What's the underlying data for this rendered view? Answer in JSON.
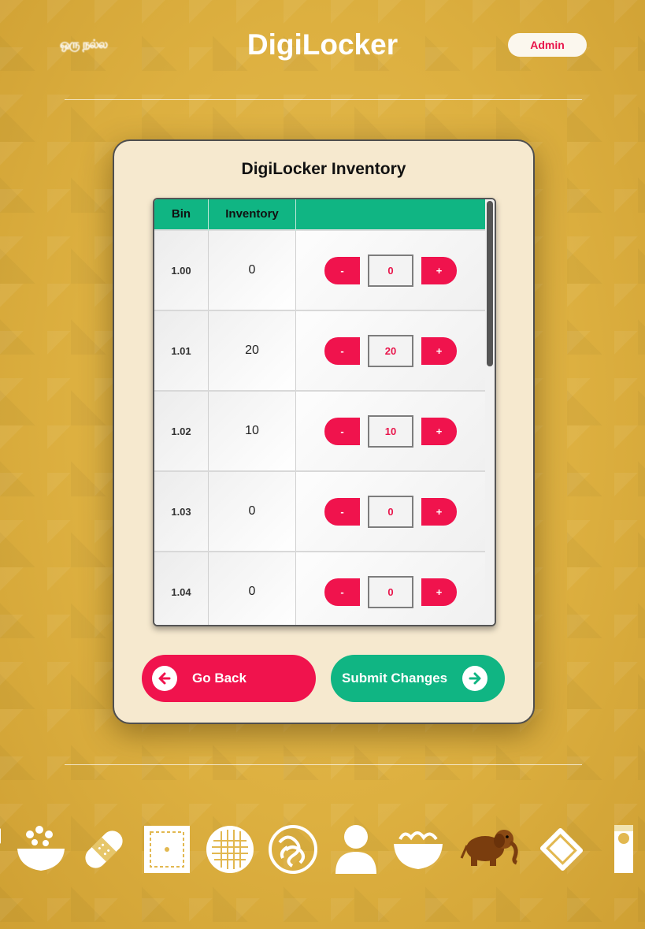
{
  "header": {
    "brand_logo_text": "ஒரு நல்ல",
    "app_title": "DigiLocker",
    "admin_label": "Admin"
  },
  "panel": {
    "title": "DigiLocker Inventory",
    "table": {
      "headers": {
        "bin": "Bin",
        "inventory": "Inventory",
        "actions": ""
      },
      "rows": [
        {
          "bin": "1.00",
          "inventory": "0",
          "qty": "0",
          "minus": "-",
          "plus": "+"
        },
        {
          "bin": "1.01",
          "inventory": "20",
          "qty": "20",
          "minus": "-",
          "plus": "+"
        },
        {
          "bin": "1.02",
          "inventory": "10",
          "qty": "10",
          "minus": "-",
          "plus": "+"
        },
        {
          "bin": "1.03",
          "inventory": "0",
          "qty": "0",
          "minus": "-",
          "plus": "+"
        },
        {
          "bin": "1.04",
          "inventory": "0",
          "qty": "0",
          "minus": "-",
          "plus": "+"
        }
      ]
    },
    "go_back_label": "Go Back",
    "submit_label": "Submit Changes"
  },
  "footer": {
    "icons": [
      "partial-icon",
      "rice-bowl-icon",
      "bandage-icon",
      "square-patch-icon",
      "waffle-icon",
      "noodles-icon",
      "person-icon",
      "noodle-bowl-icon",
      "elephant-icon",
      "bandage-diamond-icon",
      "tube-icon"
    ]
  },
  "colors": {
    "primary_red": "#f0134d",
    "primary_green": "#10b583",
    "panel_bg": "#f6e9cf",
    "page_bg": "#ddb040"
  }
}
